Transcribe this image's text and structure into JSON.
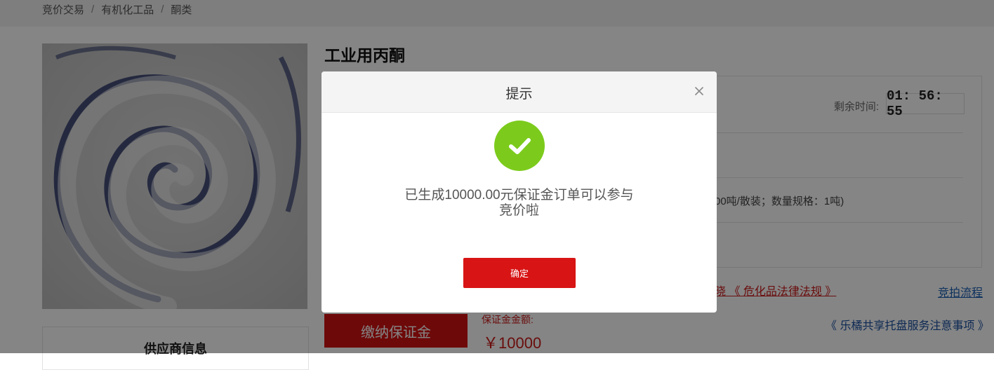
{
  "breadcrumb": {
    "items": [
      "竞价交易",
      "有机化工品",
      "酮类"
    ],
    "separator": "/"
  },
  "product": {
    "title": "工业用丙酮",
    "image_alt": "white granular powder swirl"
  },
  "auction": {
    "remaining_label": "剩余时间:",
    "remaining_time": "01: 56: 55",
    "spec_partial": "00吨/散装；数量规格：1吨)"
  },
  "links": {
    "laws": "晓 《 危化品法律法规 》",
    "process": "竞拍流程",
    "notice": "《 乐橘共享托盘服务注意事项 》"
  },
  "actions": {
    "pay_deposit": "缴纳保证金"
  },
  "deposit": {
    "label": "保证金金额:",
    "amount": "￥10000"
  },
  "supplier": {
    "title": "供应商信息"
  },
  "modal": {
    "title": "提示",
    "message": "已生成10000.00元保证金订单可以参与竞价啦",
    "confirm_label": "确定",
    "close_icon": "close-icon",
    "status_icon": "check-circle-icon"
  },
  "colors": {
    "accent_red": "#d31212",
    "success_green": "#7ccb1c",
    "link_blue": "#1a5fb4"
  }
}
